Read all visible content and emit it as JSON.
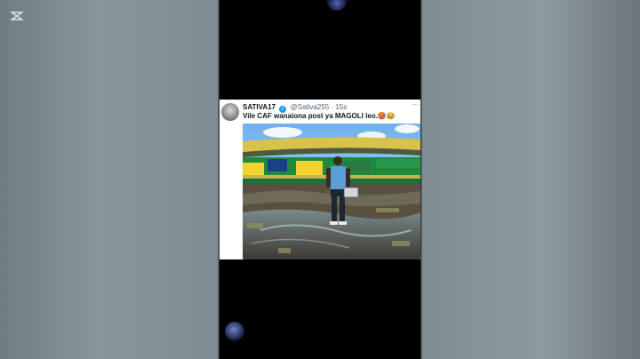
{
  "tweet": {
    "display_name": "SATIVA17",
    "handle": "@Sativa255",
    "separator": "·",
    "time": "15s",
    "text": "Vile CAF wanaiona post ya MAGOLI leo.",
    "emojis": "🥵😂"
  },
  "icons": {
    "verified": "verified-badge-icon",
    "more": "more-options-icon",
    "capcut": "capcut-logo-icon"
  },
  "colors": {
    "verified_blue": "#1d9bf0",
    "stadium_green": "#1f8a3c",
    "stadium_yellow": "#f2d22c",
    "sky": "#8ec1ef"
  }
}
